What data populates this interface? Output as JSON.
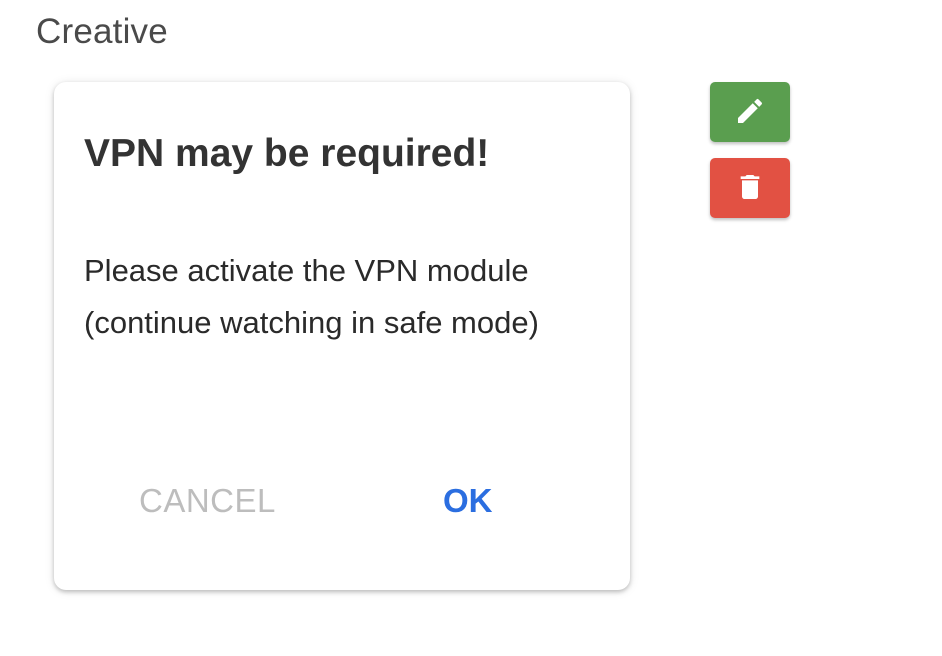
{
  "section": {
    "title": "Creative"
  },
  "dialog": {
    "title": "VPN may be required!",
    "message": "Please activate the VPN module (continue watching in safe mode)",
    "cancel_label": "CANCEL",
    "ok_label": "OK"
  },
  "actions": {
    "edit_icon": "pencil-icon",
    "delete_icon": "trash-icon"
  },
  "colors": {
    "edit_button": "#5a9e4f",
    "delete_button": "#e25143",
    "ok_text": "#2b6ee0",
    "cancel_text": "#bdbdbd"
  }
}
